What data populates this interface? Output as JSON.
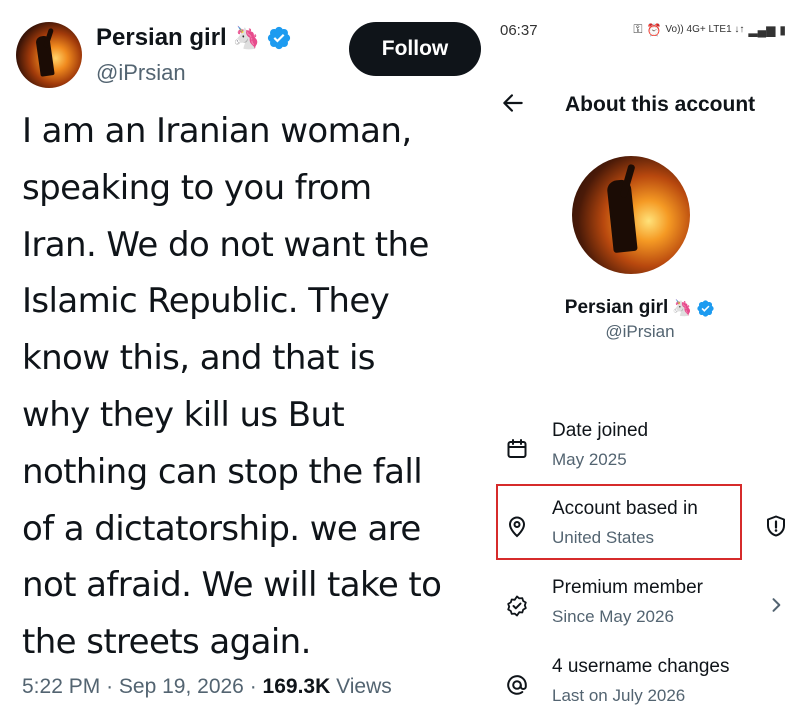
{
  "tweet": {
    "author_name": "Persian girl",
    "author_emoji": "🦄",
    "author_handle": "@iPrsian",
    "follow_label": "Follow",
    "text_lines": [
      "I am an Iranian woman,",
      "speaking to you from",
      "Iran. We do not want the",
      "Islamic Republic. They",
      "know this, and that is",
      "why they kill us But",
      "nothing can stop the fall",
      "of a dictatorship. we are",
      "not afraid. We will take to",
      "the streets again."
    ],
    "time": "5:22 PM",
    "separator": "·",
    "date": "Sep 19, 2026",
    "views_count": "169.3K",
    "views_label": "Views"
  },
  "phone": {
    "status_time": "06:37",
    "status_network": "Vo)) 4G+ LTE1 ↓↑",
    "title": "About this account",
    "profile_name": "Persian girl",
    "profile_emoji": "🦄",
    "profile_handle": "@iPrsian",
    "rows": [
      {
        "label": "Date joined",
        "value": "May 2025",
        "icon": "calendar-icon"
      },
      {
        "label": "Account based in",
        "value": "United States",
        "icon": "location-pin-icon",
        "trail_icon": "shield-icon"
      },
      {
        "label": "Premium member",
        "value": "Since May 2026",
        "icon": "verified-badge-icon",
        "trail_icon": "chevron-right-icon"
      },
      {
        "label": "4 username changes",
        "value": "Last on July 2026",
        "icon": "at-sign-icon"
      }
    ],
    "highlight_color": "#d62b2b"
  },
  "colors": {
    "verified_blue": "#1d9bf0",
    "text_primary": "#0f1419",
    "text_secondary": "#536471",
    "follow_bg": "#0f1419"
  }
}
